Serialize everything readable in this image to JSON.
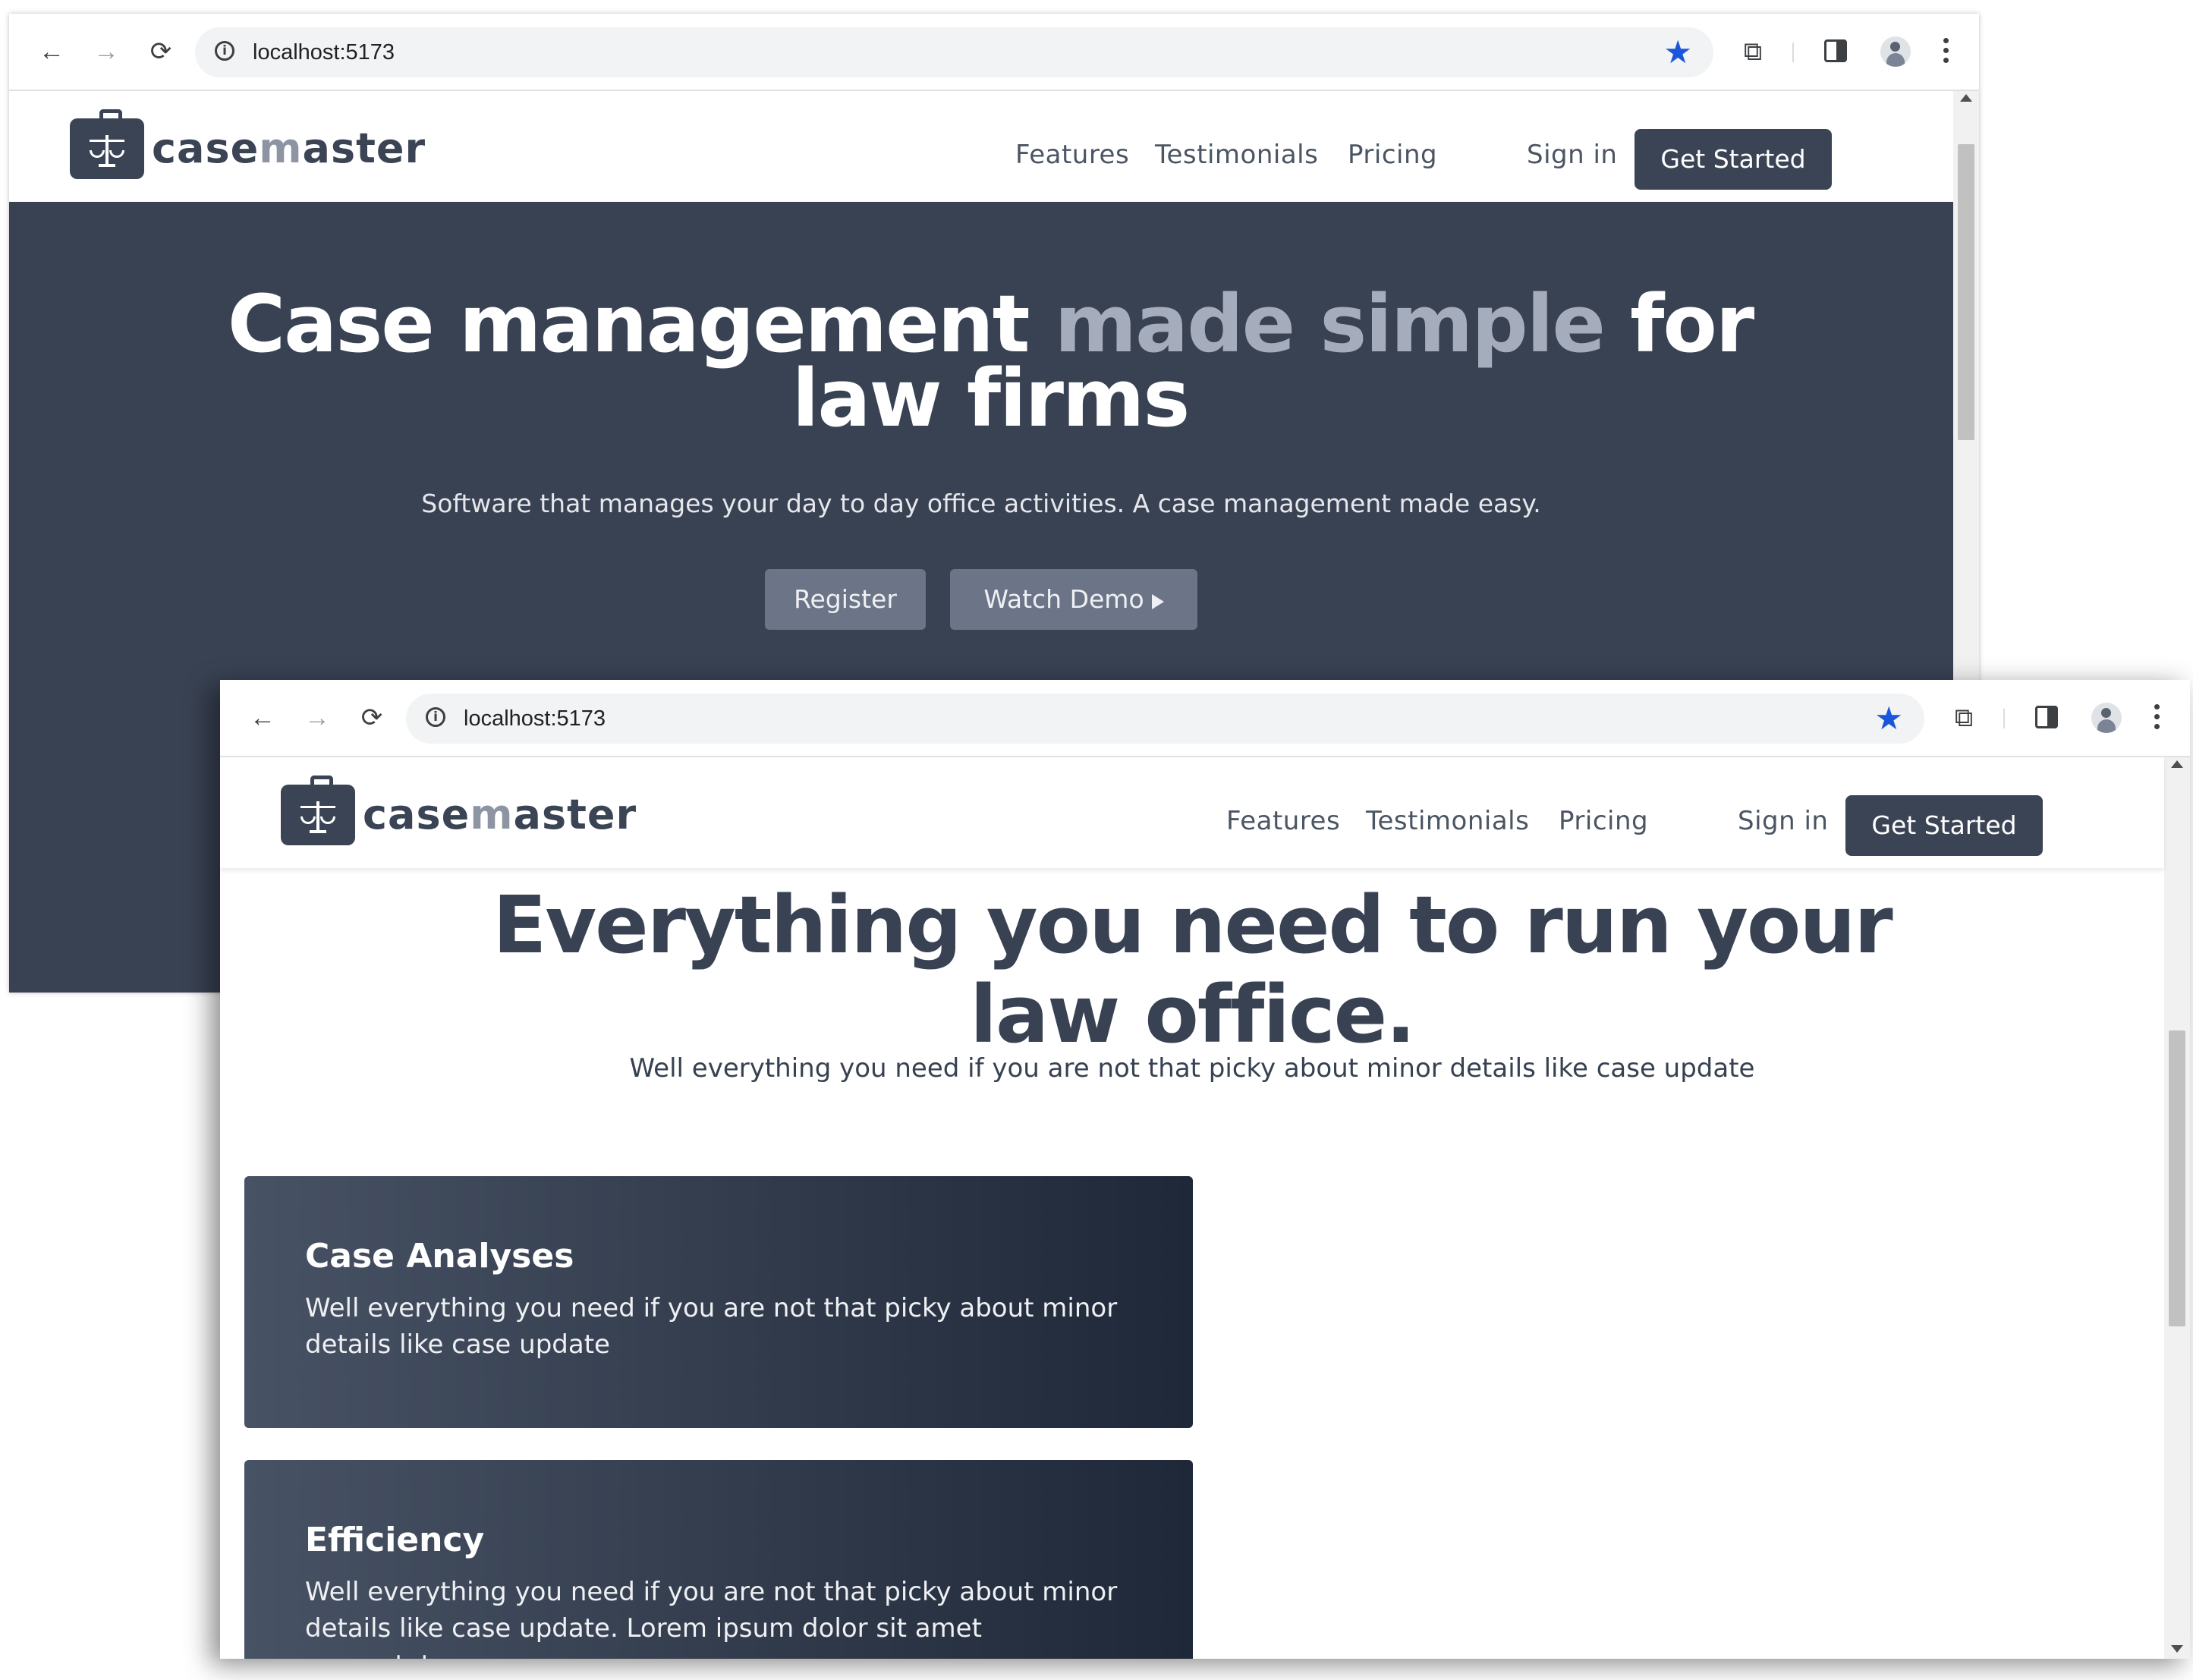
{
  "browser": {
    "url": "localhost:5173",
    "back_glyph": "←",
    "forward_glyph": "→",
    "reload_glyph": "⟳",
    "info_glyph": "i",
    "star_glyph": "★",
    "extensions_glyph": "⧉",
    "icons": [
      "back-icon",
      "forward-icon",
      "reload-icon",
      "info-icon",
      "bookmark-star-icon",
      "extensions-icon",
      "side-panel-icon",
      "profile-avatar-icon",
      "menu-kebab-icon"
    ],
    "accent_color": "#1a56db"
  },
  "site": {
    "brand_primary": "case",
    "brand_accent": "m",
    "brand_rest": "aster",
    "nav": {
      "features": "Features",
      "testimonials": "Testimonials",
      "pricing": "Pricing",
      "sign_in": "Sign in",
      "cta": "Get Started"
    },
    "colors": {
      "primary": "#394253",
      "accent": "#a5adbc"
    }
  },
  "hero": {
    "title_part1": "Case management",
    "title_highlight": "made simple",
    "title_part2": "for law firms",
    "subtitle": "Software that manages your day to day office activities. A case management made easy.",
    "register": "Register",
    "watch_demo": "Watch Demo"
  },
  "features": {
    "title": "Everything you need to run your law office.",
    "subtitle": "Well everything you need if you are not that picky about minor details like case update",
    "cards": [
      {
        "title": "Case Analyses",
        "body": "Well everything you need if you are not that picky about minor details like case update"
      },
      {
        "title": "Efficiency",
        "body": "Well everything you need if you are not that picky about minor details like case update. Lorem ipsum dolor sit amet consectetur"
      }
    ]
  }
}
